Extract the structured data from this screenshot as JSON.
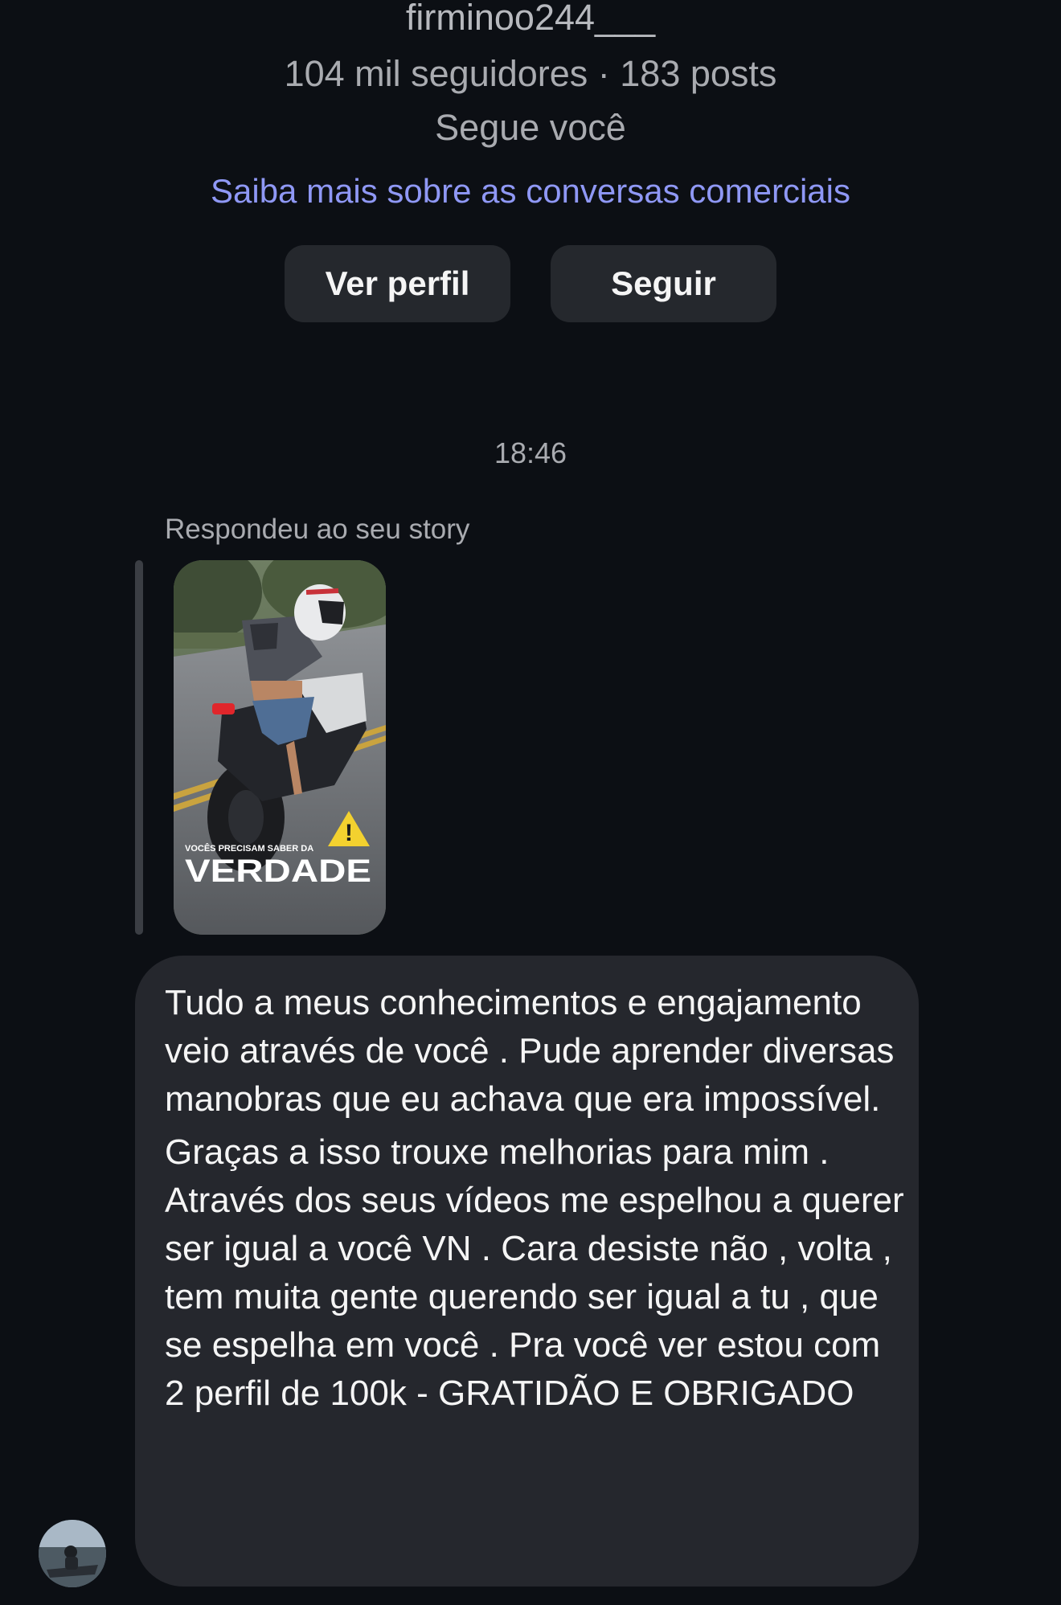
{
  "profile": {
    "username": "firminoo244___",
    "stats": "104 mil seguidores · 183 posts",
    "follows_you": "Segue você",
    "learn_more_link": "Saiba mais sobre as conversas comerciais",
    "view_profile_button": "Ver perfil",
    "follow_button": "Seguir"
  },
  "conversation": {
    "timestamp": "18:46",
    "reply_label": "Respondeu ao seu story",
    "story_overlay": {
      "small_text": "VOCÊS PRECISAM SABER DA",
      "big_text": "VERDADE",
      "warning_symbol": "!"
    },
    "message": {
      "paragraph_1": "Tudo a meus conhecimentos e engajamento veio através de você . Pude aprender diversas manobras que eu achava que era impossível.",
      "paragraph_2": "Graças a isso trouxe melhorias para mim . Através dos seus vídeos me espelhou a querer ser igual a você VN . Cara desiste não , volta , tem muita gente querendo ser igual a tu , que se espelha em você . Pra você ver estou com 2 perfil de 100k - GRATIDÃO E OBRIGADO"
    }
  },
  "colors": {
    "background": "#0c0f14",
    "bubble": "#25272d",
    "button": "#25282d",
    "link": "#8f98f5",
    "muted_text": "#a9abb0"
  }
}
